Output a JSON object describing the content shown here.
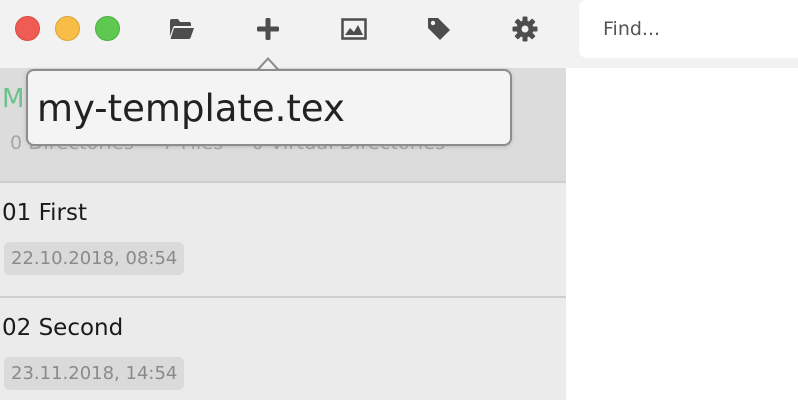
{
  "window": {
    "controls": [
      "close",
      "minimize",
      "zoom"
    ]
  },
  "toolbar": {
    "buttons": [
      {
        "id": "open",
        "icon": "folder-open-icon"
      },
      {
        "id": "add",
        "icon": "plus-icon"
      },
      {
        "id": "image",
        "icon": "image-icon"
      },
      {
        "id": "tag",
        "icon": "tag-icon"
      },
      {
        "id": "settings",
        "icon": "gear-icon"
      }
    ],
    "icon_color": "#4d4d4d"
  },
  "search": {
    "placeholder": "Find..."
  },
  "directory": {
    "name": "M",
    "stats": {
      "directories": "0 Directories",
      "files": "7 Files",
      "virtual": "0 Virtual Directories"
    },
    "name_color": "#6cc28a"
  },
  "files": [
    {
      "title": "01 First",
      "date": "22.10.2018, 08:54"
    },
    {
      "title": "02 Second",
      "date": "23.11.2018, 14:54"
    }
  ],
  "new_file_popover": {
    "value": "my-template.tex"
  }
}
